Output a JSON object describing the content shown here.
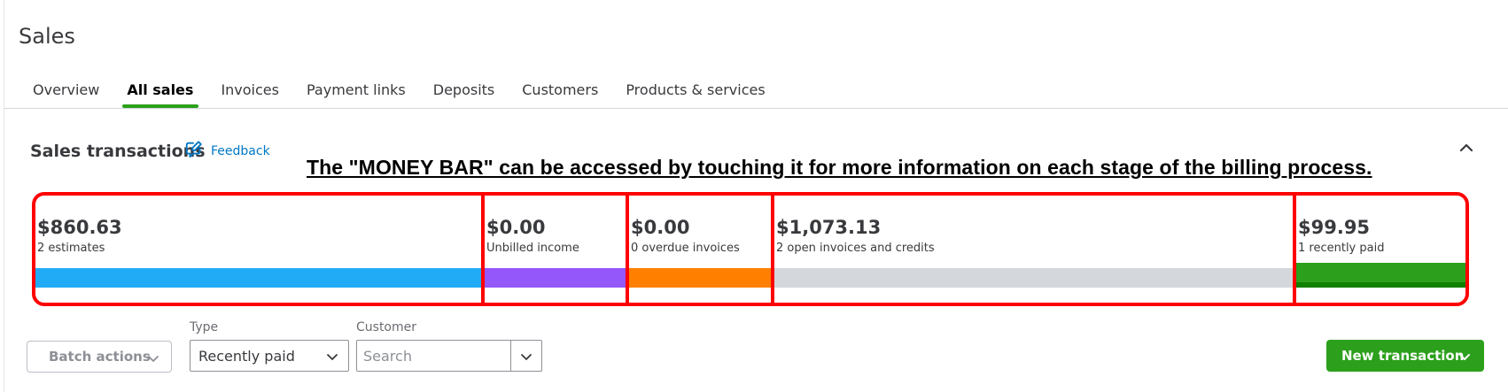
{
  "page": {
    "title": "Sales"
  },
  "tabs": [
    {
      "label": "Overview",
      "active": false
    },
    {
      "label": "All sales",
      "active": true
    },
    {
      "label": "Invoices",
      "active": false
    },
    {
      "label": "Payment links",
      "active": false
    },
    {
      "label": "Deposits",
      "active": false
    },
    {
      "label": "Customers",
      "active": false
    },
    {
      "label": "Products & services",
      "active": false
    }
  ],
  "section": {
    "title": "Sales transactions",
    "feedback_label": "Feedback",
    "feedback_icon": "feedback-icon",
    "collapse_icon": "chevron-up-icon"
  },
  "annotation": "The \"MONEY BAR\" can be accessed by touching it for more information on each stage of the billing process.",
  "money_bar": {
    "segments": [
      {
        "amount": "$860.63",
        "label": "2 estimates",
        "color": "#21abf6"
      },
      {
        "amount": "$0.00",
        "label": "Unbilled income",
        "color": "#9457fa"
      },
      {
        "amount": "$0.00",
        "label": "0 overdue invoices",
        "color": "#ff8000"
      },
      {
        "amount": "$1,073.13",
        "label": "2 open invoices and credits",
        "color": "#d4d7dc"
      },
      {
        "amount": "$99.95",
        "label": "1 recently paid",
        "color": "#2ca01c"
      }
    ],
    "highlight_color": "#ff0000"
  },
  "filters": {
    "batch_actions_label": "Batch actions",
    "type_label": "Type",
    "type_value": "Recently paid",
    "customer_label": "Customer",
    "customer_placeholder": "Search"
  },
  "actions": {
    "new_transaction_label": "New transaction"
  },
  "colors": {
    "accent": "#2ca01c",
    "link": "#0077c5"
  }
}
